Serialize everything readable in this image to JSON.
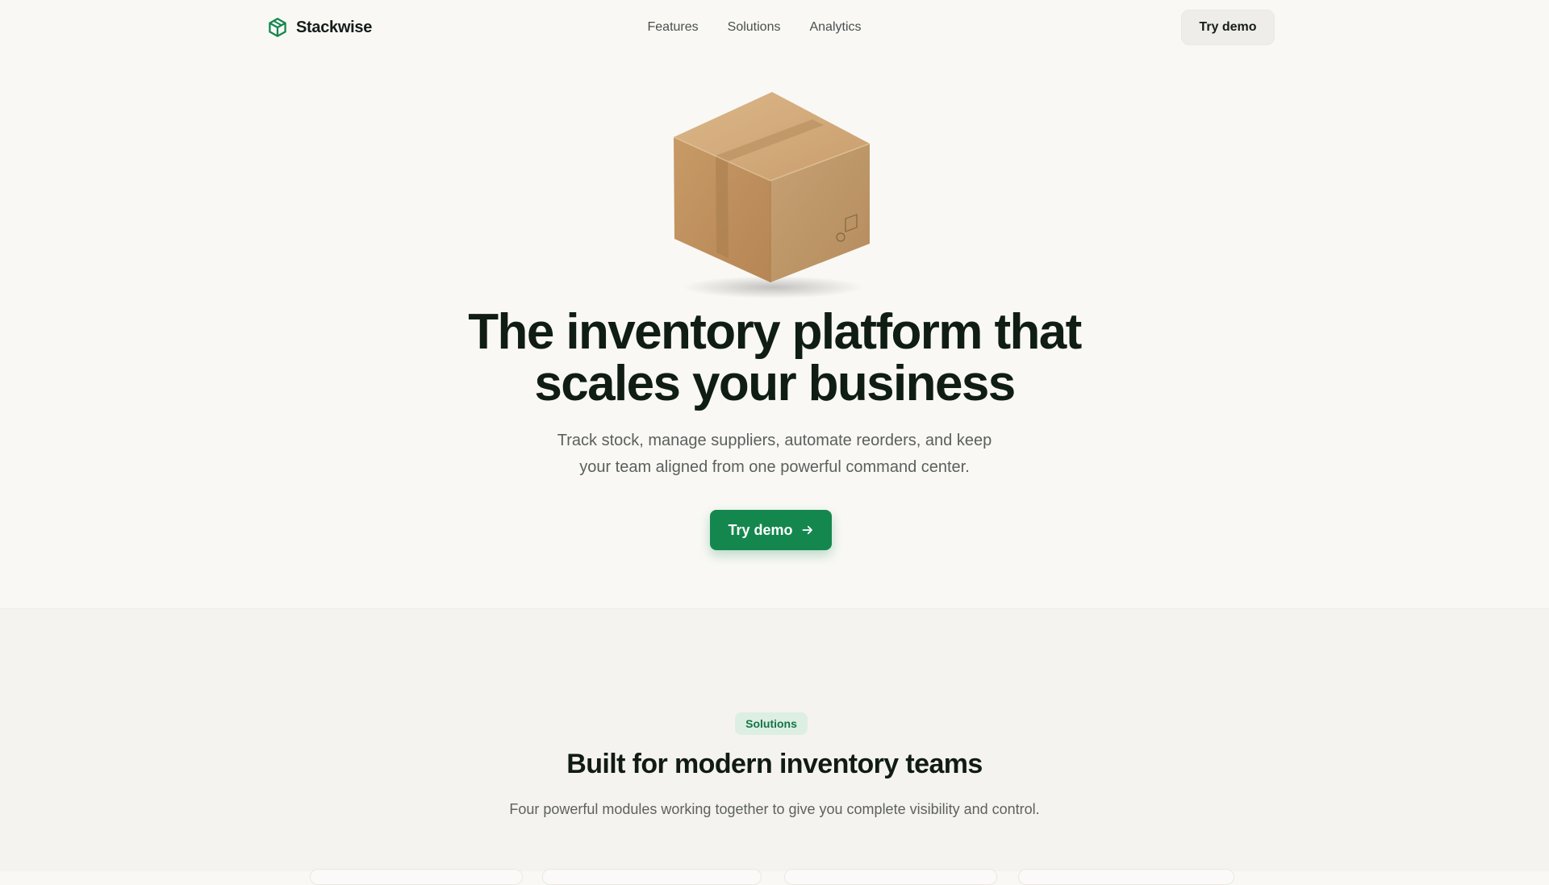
{
  "nav": {
    "brand": "Stackwise",
    "links": [
      "Features",
      "Solutions",
      "Analytics"
    ],
    "cta_label": "Try demo"
  },
  "hero": {
    "title_line1": "The inventory platform that",
    "title_line2": "scales your business",
    "subtitle_line1": "Track stock, manage suppliers, automate reorders, and keep",
    "subtitle_line2": "your team aligned from one powerful command center.",
    "cta_label": "Try demo"
  },
  "solutions": {
    "badge": "Solutions",
    "title": "Built for modern inventory teams",
    "subtitle": "Four powerful modules working together to give you complete visibility and control."
  },
  "icons": {
    "brand": "cube-logo-icon",
    "cta_arrow": "arrow-right-icon",
    "hero_image": "cardboard-box-illustration"
  },
  "colors": {
    "background": "#f9f8f5",
    "section_background": "#f5f3ef",
    "accent": "#14874e",
    "badge_background": "#dcefe2",
    "badge_text": "#157446",
    "heading": "#0f1d14",
    "body_text": "#5b605d"
  }
}
